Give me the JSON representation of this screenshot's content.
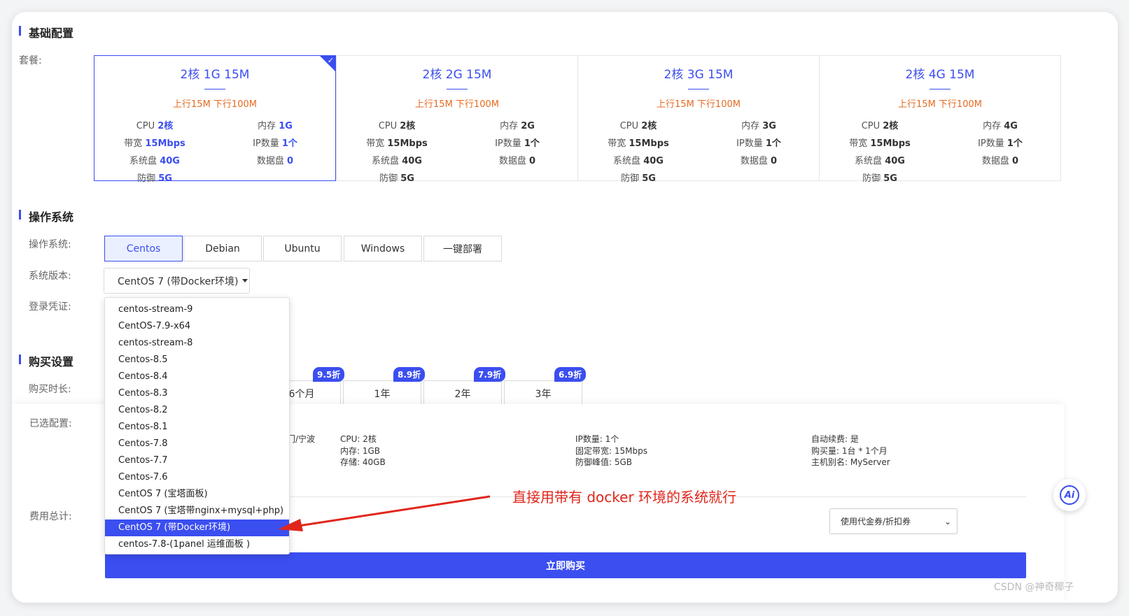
{
  "basic": {
    "section_title": "基础配置",
    "package_label": "套餐:",
    "packages": [
      {
        "name": "2核 1G 15M",
        "speed": "上行15M 下行100M",
        "cpu_k": "CPU",
        "cpu_v": "2核",
        "mem_k": "内存",
        "mem_v": "1G",
        "bw_k": "带宽",
        "bw_v": "15Mbps",
        "ip_k": "IP数量",
        "ip_v": "1个",
        "sys_k": "系统盘",
        "sys_v": "40G",
        "data_k": "数据盘",
        "data_v": "0",
        "def_k": "防御",
        "def_v": "5G",
        "selected": true
      },
      {
        "name": "2核 2G 15M",
        "speed": "上行15M 下行100M",
        "cpu_k": "CPU",
        "cpu_v": "2核",
        "mem_k": "内存",
        "mem_v": "2G",
        "bw_k": "带宽",
        "bw_v": "15Mbps",
        "ip_k": "IP数量",
        "ip_v": "1个",
        "sys_k": "系统盘",
        "sys_v": "40G",
        "data_k": "数据盘",
        "data_v": "0",
        "def_k": "防御",
        "def_v": "5G",
        "selected": false
      },
      {
        "name": "2核 3G 15M",
        "speed": "上行15M 下行100M",
        "cpu_k": "CPU",
        "cpu_v": "2核",
        "mem_k": "内存",
        "mem_v": "3G",
        "bw_k": "带宽",
        "bw_v": "15Mbps",
        "ip_k": "IP数量",
        "ip_v": "1个",
        "sys_k": "系统盘",
        "sys_v": "40G",
        "data_k": "数据盘",
        "data_v": "0",
        "def_k": "防御",
        "def_v": "5G",
        "selected": false
      },
      {
        "name": "2核 4G 15M",
        "speed": "上行15M 下行100M",
        "cpu_k": "CPU",
        "cpu_v": "2核",
        "mem_k": "内存",
        "mem_v": "4G",
        "bw_k": "带宽",
        "bw_v": "15Mbps",
        "ip_k": "IP数量",
        "ip_v": "1个",
        "sys_k": "系统盘",
        "sys_v": "40G",
        "data_k": "数据盘",
        "data_v": "0",
        "def_k": "防御",
        "def_v": "5G",
        "selected": false
      }
    ]
  },
  "os": {
    "section_title": "操作系统",
    "os_label": "操作系统:",
    "version_label": "系统版本:",
    "credential_label": "登录凭证:",
    "tabs": [
      "Centos",
      "Debian",
      "Ubuntu",
      "Windows",
      "一键部署"
    ],
    "active_tab": "Centos",
    "version_value": "CentOS 7 (带Docker环境)",
    "options": [
      "centos-stream-9",
      "CentOS-7.9-x64",
      "centos-stream-8",
      "Centos-8.5",
      "Centos-8.4",
      "Centos-8.3",
      "Centos-8.2",
      "Centos-8.1",
      "Centos-7.8",
      "Centos-7.7",
      "Centos-7.6",
      "CentOS 7 (宝塔面板)",
      "CentOS 7 (宝塔带nginx+mysql+php)",
      "CentOS 7 (带Docker环境)",
      "centos-7.8-(1panel 运维面板 )"
    ],
    "selected_option": "CentOS 7 (带Docker环境)"
  },
  "purchase": {
    "section_title": "购买设置",
    "duration_label": "购买时长:",
    "durations": [
      {
        "label": "6个月",
        "discount": "9.5折"
      },
      {
        "label": "1年",
        "discount": "8.9折"
      },
      {
        "label": "2年",
        "discount": "7.9折"
      },
      {
        "label": "3年",
        "discount": "6.9折"
      }
    ]
  },
  "summary": {
    "selected_label": "已选配置:",
    "region_fragment": "门/宁波",
    "cpu_k": "CPU:",
    "cpu_v": "2核",
    "mem_k": "内存:",
    "mem_v": "1GB",
    "storage_k": "存储:",
    "storage_v": "40GB",
    "ip_k": "IP数量:",
    "ip_v": "1个",
    "bw_k": "固定带宽:",
    "bw_v": "15Mbps",
    "defense_k": "防御峰值:",
    "defense_v": "5GB",
    "renew_k": "自动续费:",
    "renew_v": "是",
    "qty_k": "购买量:",
    "qty_v": "1台 * 1个月",
    "alias_k": "主机别名:",
    "alias_v": "MyServer",
    "total_label": "费用总计:",
    "coupon_placeholder": "使用代金券/折扣券",
    "buy_label": "立即购买"
  },
  "annotation": "直接用带有 docker 环境的系统就行",
  "ai_label": "Ai",
  "watermark": "CSDN @神奇椰子",
  "colors": {
    "accent": "#3b4ef0",
    "orange": "#e66a1f",
    "annotation_red": "#e0261c"
  }
}
